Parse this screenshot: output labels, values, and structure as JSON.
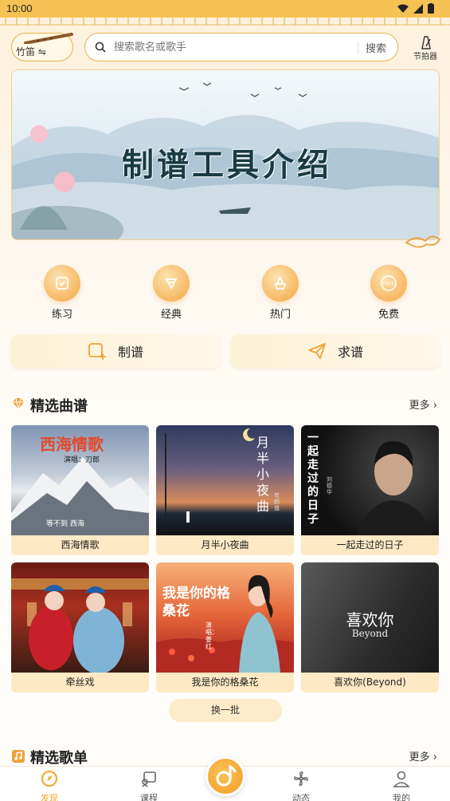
{
  "status_bar": {
    "time": "10:00"
  },
  "header": {
    "instrument_label": "竹笛 ⇋",
    "search_placeholder": "搜索歌名或歌手",
    "search_button": "搜索",
    "metronome_label": "节拍器"
  },
  "banner": {
    "title": "制谱工具介绍"
  },
  "categories": [
    {
      "label": "练习",
      "icon": "practice-icon"
    },
    {
      "label": "经典",
      "icon": "classic-icon"
    },
    {
      "label": "热门",
      "icon": "hot-icon"
    },
    {
      "label": "免费",
      "icon": "free-icon",
      "badge": "FREE"
    }
  ],
  "actions": [
    {
      "label": "制谱",
      "icon": "compose-icon"
    },
    {
      "label": "求谱",
      "icon": "request-icon"
    }
  ],
  "featured_scores": {
    "title": "精选曲谱",
    "more": "更多 ›",
    "items": [
      {
        "label": "西海情歌",
        "art_title": "西海情歌",
        "art_sub": "演唱：刀郎",
        "art_caption": "等不到 西海"
      },
      {
        "label": "月半小夜曲",
        "art_title": "月半小夜曲",
        "art_sub": "有颜值"
      },
      {
        "label": "一起走过的日子",
        "art_title": "一起走过的日子",
        "art_sub": "刘德华"
      },
      {
        "label": "牵丝戏"
      },
      {
        "label": "我是你的格桑花",
        "art_title": "我是你的格桑花",
        "art_sub": "演唱：姜红"
      },
      {
        "label": "喜欢你(Beyond)",
        "art_title": "喜欢你",
        "art_sub": "Beyond"
      }
    ],
    "refresh": "换一批"
  },
  "featured_playlists": {
    "title": "精选歌单",
    "more": "更多 ›"
  },
  "nav": [
    {
      "label": "发现",
      "icon": "discover-icon",
      "active": true
    },
    {
      "label": "课程",
      "icon": "course-icon"
    },
    {
      "label": "动态",
      "icon": "feed-icon"
    },
    {
      "label": "我的",
      "icon": "profile-icon"
    }
  ],
  "colors": {
    "accent": "#f5a623",
    "status_bar": "#f6c253",
    "card_label_bg": "#fde9c4"
  }
}
